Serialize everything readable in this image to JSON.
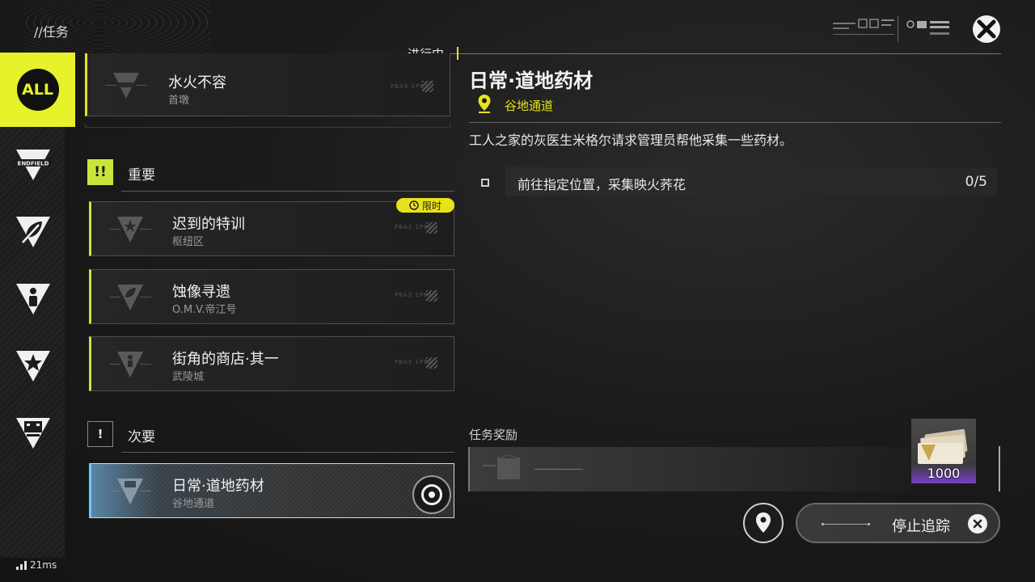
{
  "header": {
    "breadcrumb": "//任务",
    "status_label": "进行中"
  },
  "sidebar": {
    "all_label": "ALL",
    "icons": [
      "endfield-category-icon",
      "leaf-category-icon",
      "info-category-icon",
      "star-category-icon",
      "box-category-icon"
    ],
    "endfield_text": "ENDFIELD"
  },
  "in_progress_quest": {
    "title": "水火不容",
    "location": "首墩",
    "code": "PBA3 1PBA"
  },
  "important_section": {
    "badge": "!!",
    "title": "重要",
    "quests": [
      {
        "title": "迟到的特训",
        "location": "枢纽区",
        "code": "PBA3 1PBA",
        "tag": "限时"
      },
      {
        "title": "蚀像寻遗",
        "location": "O.M.V.帝江号",
        "code": "PBA3 1PBA"
      },
      {
        "title": "街角的商店·其一",
        "location": "武陵城",
        "code": "PBA3 1PBA"
      }
    ]
  },
  "minor_section": {
    "badge": "!",
    "title": "次要",
    "quests": [
      {
        "title": "日常·道地药材",
        "location": "谷地通道",
        "code": "PBA3 1PBA",
        "tracked": true
      }
    ]
  },
  "detail": {
    "title": "日常·道地药材",
    "location": "谷地通道",
    "description": "工人之家的灰医生米格尔请求管理员帮他采集一些药材。",
    "objectives": [
      {
        "text": "前往指定位置，采集映火荞花",
        "progress": "0/5"
      }
    ],
    "reward_label": "任务奖励",
    "reward_item": {
      "quantity": "1000",
      "rarity_color": "#7a3ec4"
    }
  },
  "actions": {
    "stop_tracking": "停止追踪"
  },
  "footer": {
    "latency": "21ms"
  },
  "colors": {
    "accent_yellow": "#e7f22a",
    "important_green": "#c9e53a",
    "tracked_blue": "#6ec6ff"
  }
}
